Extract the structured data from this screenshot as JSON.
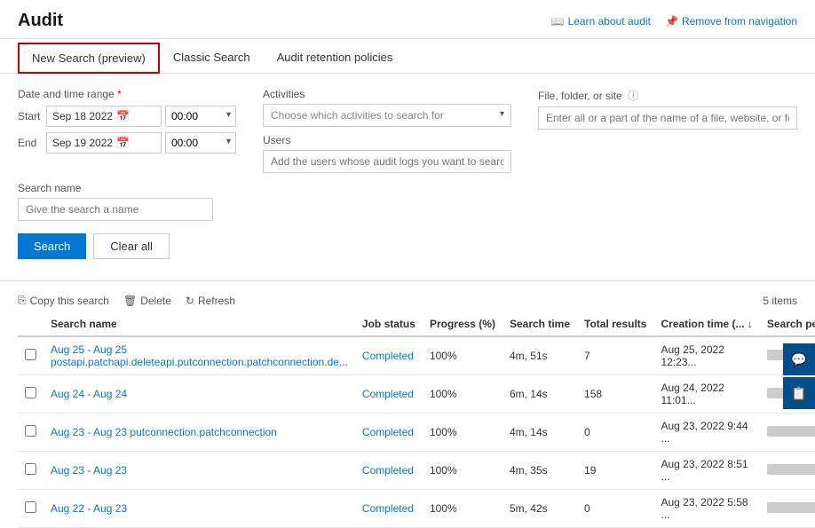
{
  "page": {
    "title": "Audit",
    "topLinks": [
      {
        "label": "Learn about audit",
        "icon": "book-icon"
      },
      {
        "label": "Remove from navigation",
        "icon": "unpin-icon"
      }
    ]
  },
  "tabs": [
    {
      "id": "new-search",
      "label": "New Search (preview)",
      "active": true
    },
    {
      "id": "classic-search",
      "label": "Classic Search",
      "active": false
    },
    {
      "id": "retention-policies",
      "label": "Audit retention policies",
      "active": false
    }
  ],
  "form": {
    "dateTimeLabel": "Date and time range",
    "requiredMark": "*",
    "startLabel": "Start",
    "endLabel": "End",
    "startDate": "Sep 18 2022",
    "startTime": "00:00",
    "endDate": "Sep 19 2022",
    "endTime": "00:00",
    "activitiesLabel": "Activities",
    "activitiesPlaceholder": "Choose which activities to search for",
    "usersLabel": "Users",
    "usersPlaceholder": "Add the users whose audit logs you want to search",
    "fileLabel": "File, folder, or site",
    "filePlaceholder": "Enter all or a part of the name of a file, website, or folder",
    "searchNameLabel": "Search name",
    "searchNamePlaceholder": "Give the search a name",
    "searchButton": "Search",
    "clearButton": "Clear all"
  },
  "toolbar": {
    "copyLabel": "Copy this search",
    "deleteLabel": "Delete",
    "refreshLabel": "Refresh",
    "itemsCount": "5 items"
  },
  "table": {
    "columns": [
      {
        "id": "search-name",
        "label": "Search name"
      },
      {
        "id": "job-status",
        "label": "Job status"
      },
      {
        "id": "progress",
        "label": "Progress (%)"
      },
      {
        "id": "search-time",
        "label": "Search time"
      },
      {
        "id": "total-results",
        "label": "Total results"
      },
      {
        "id": "creation-time",
        "label": "Creation time (... ↓"
      },
      {
        "id": "performed-by",
        "label": "Search performed by"
      }
    ],
    "rows": [
      {
        "name": "Aug 25 - Aug 25 postapi.patchapi.deleteapi.putconnection.patchconnection.de...",
        "status": "Completed",
        "progress": "100%",
        "searchTime": "4m, 51s",
        "totalResults": "7",
        "creationTime": "Aug 25, 2022 12:23...",
        "performedBy": "blurred-90"
      },
      {
        "name": "Aug 24 - Aug 24",
        "status": "Completed",
        "progress": "100%",
        "searchTime": "6m, 14s",
        "totalResults": "158",
        "creationTime": "Aug 24, 2022 11:01...",
        "performedBy": "blurred-90"
      },
      {
        "name": "Aug 23 - Aug 23 putconnection.patchconnection",
        "status": "Completed",
        "progress": "100%",
        "searchTime": "4m, 14s",
        "totalResults": "0",
        "creationTime": "Aug 23, 2022 9:44 ...",
        "performedBy": "blurred-90"
      },
      {
        "name": "Aug 23 - Aug 23",
        "status": "Completed",
        "progress": "100%",
        "searchTime": "4m, 35s",
        "totalResults": "19",
        "creationTime": "Aug 23, 2022 8:51 ...",
        "performedBy": "blurred-90"
      },
      {
        "name": "Aug 22 - Aug 23",
        "status": "Completed",
        "progress": "100%",
        "searchTime": "5m, 42s",
        "totalResults": "0",
        "creationTime": "Aug 23, 2022 5:58 ...",
        "performedBy": "blurred-90"
      }
    ]
  },
  "rightPanel": [
    {
      "id": "chat-icon",
      "symbol": "💬"
    },
    {
      "id": "feedback-icon",
      "symbol": "📋"
    }
  ]
}
